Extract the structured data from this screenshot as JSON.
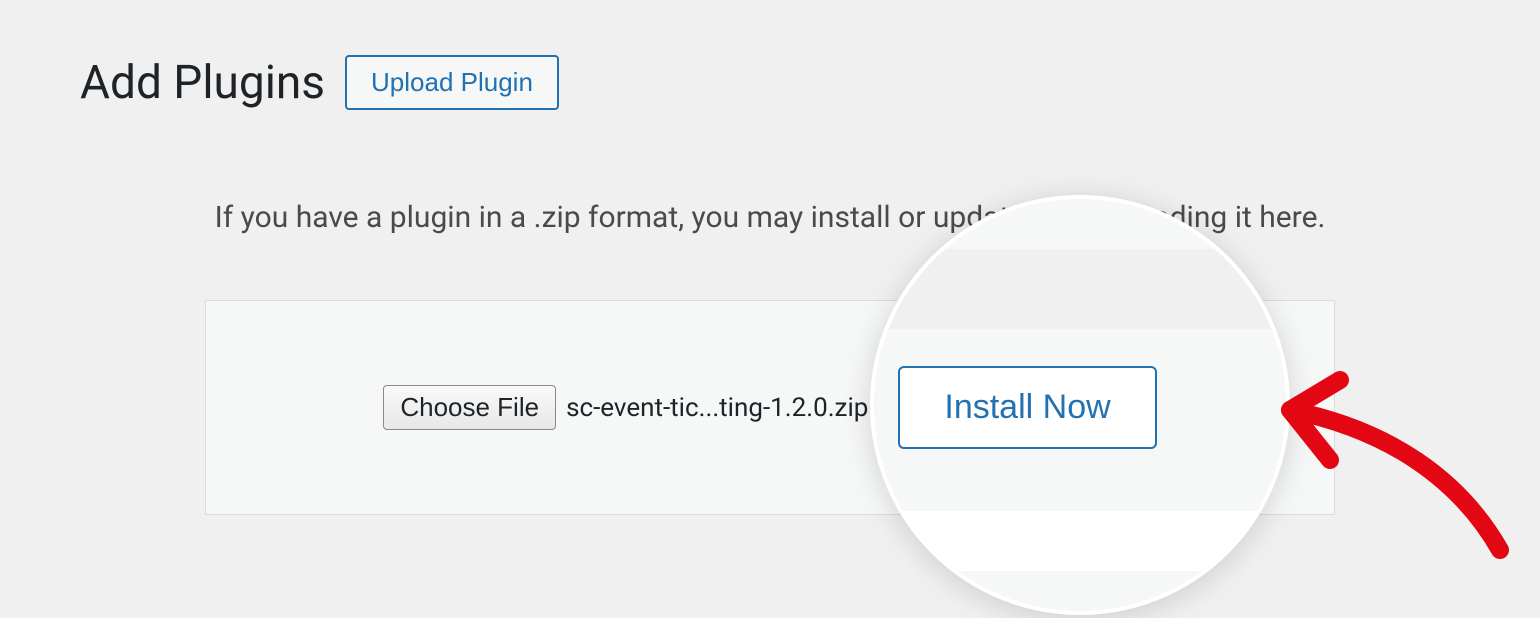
{
  "header": {
    "title": "Add Plugins",
    "upload_button": "Upload Plugin"
  },
  "instructions": "If you have a plugin in a .zip format, you may install or update it by uploading it here.",
  "upload_panel": {
    "choose_file_label": "Choose File",
    "selected_file": "sc-event-tic...ting-1.2.0.zip",
    "install_button": "Install Now"
  }
}
